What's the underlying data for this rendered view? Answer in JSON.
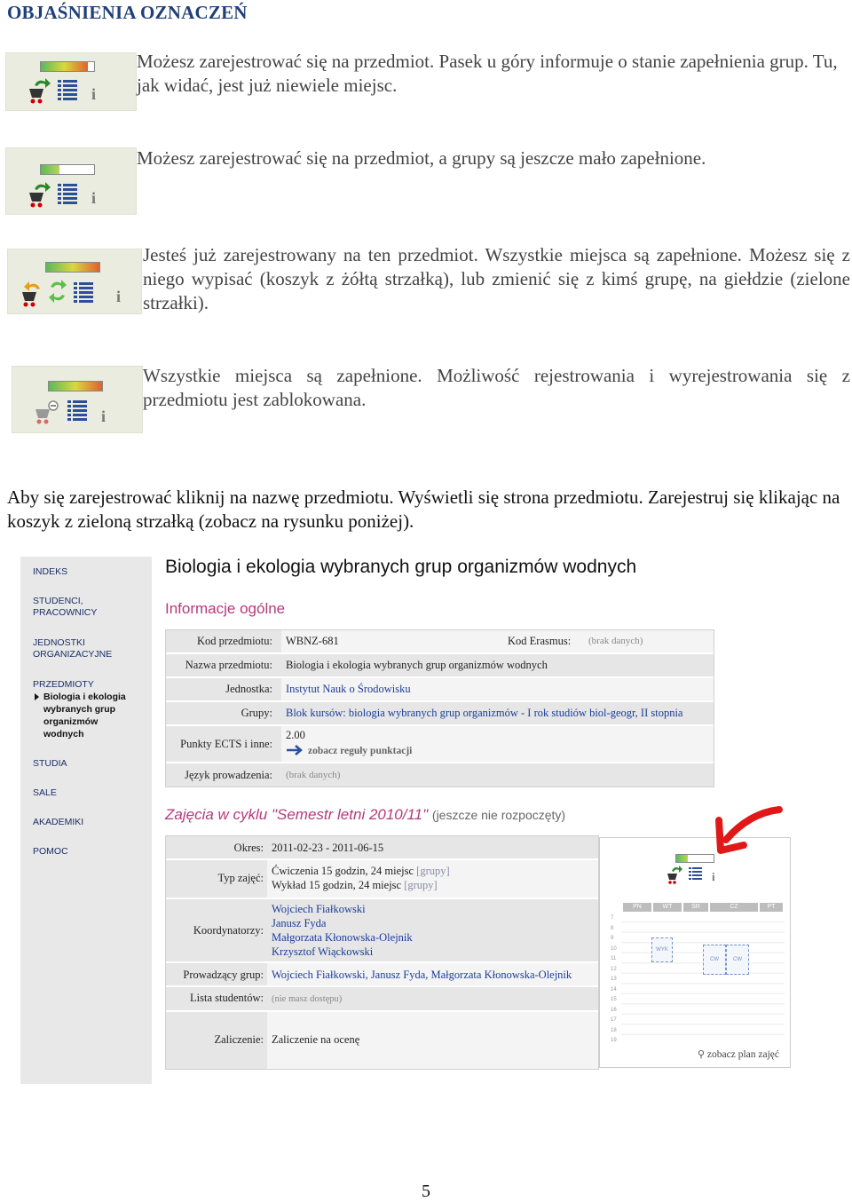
{
  "heading": "OBJAŚNIENIA OZNACZEŃ",
  "legend": [
    {
      "text": "Możesz zarejestrować się na przedmiot. Pasek u góry informuje o stanie zapełnienia grup. Tu, jak widać, jest już niewiele miejsc.",
      "fill_fraction": 0.88
    },
    {
      "text": "Możesz zarejestrować się na przedmiot, a grupy są jeszcze mało zapełnione.",
      "fill_fraction": 0.35
    },
    {
      "text": "Jesteś już zarejestrowany na ten przedmiot. Wszystkie miejsca są zapełnione. Możesz się z niego wypisać (koszyk z żółtą strzałką), lub zmienić się z kimś grupę, na giełdzie (zielone strzałki).",
      "fill_fraction": 1.0
    },
    {
      "text": "Wszystkie miejsca są zapełnione. Możliwość rejestrowania i wyrejestrowania się z przedmiotu jest zablokowana.",
      "fill_fraction": 1.0
    }
  ],
  "instruction": "Aby się zarejestrować kliknij na nazwę przedmiotu. Wyświetli się strona przedmiotu. Zarejestruj się klikając na koszyk z zieloną strzałką (zobacz na rysunku poniżej).",
  "screenshot": {
    "nav": {
      "indeks": "INDEKS",
      "studenci_1": "STUDENCI,",
      "studenci_2": "PRACOWNICY",
      "jednostki_1": "JEDNOSTKI",
      "jednostki_2": "ORGANIZACYJNE",
      "przedmioty": "PRZEDMIOTY",
      "current_1": "Biologia i ekologia",
      "current_2": "wybranych grup",
      "current_3": "organizmów",
      "current_4": "wodnych",
      "studia": "STUDIA",
      "sale": "SALE",
      "akademiki": "AKADEMIKI",
      "pomoc": "POMOC"
    },
    "course_title": "Biologia i ekologia wybranych grup organizmów wodnych",
    "general_heading": "Informacje ogólne",
    "general": {
      "kod_label": "Kod przedmiotu:",
      "kod_value": "WBNZ-681",
      "erasmus_label": "Kod Erasmus:",
      "erasmus_value": "(brak danych)",
      "nazwa_label": "Nazwa przedmiotu:",
      "nazwa_value": "Biologia i ekologia wybranych grup organizmów wodnych",
      "jednostka_label": "Jednostka:",
      "jednostka_value": "Instytut Nauk o Środowisku",
      "grupy_label": "Grupy:",
      "grupy_value": "Blok kursów: biologia wybranych grup organizmów - I rok studiów biol-geogr, II stopnia",
      "ects_label": "Punkty ECTS i inne:",
      "ects_value": "2.00",
      "ects_link": "zobacz reguły punktacji",
      "jezyk_label": "Język prowadzenia:",
      "jezyk_value": "(brak danych)"
    },
    "cycle_heading": "Zajęcia w cyklu \"Semestr letni 2010/11\"",
    "cycle_note": "(jeszcze nie rozpoczęty)",
    "cycle": {
      "okres_label": "Okres:",
      "okres_value": "2011-02-23 - 2011-06-15",
      "typ_label": "Typ zajęć:",
      "typ_1": "Ćwiczenia 15 godzin, 24 miejsc",
      "typ_1_link": "[grupy]",
      "typ_2": "Wykład 15 godzin, 24 miejsc",
      "typ_2_link": "[grupy]",
      "koord_label": "Koordynatorzy:",
      "koord": [
        "Wojciech Fiałkowski",
        "Janusz Fyda",
        "Małgorzata Kłonowska-Olejnik",
        "Krzysztof Wiąckowski"
      ],
      "prow_label": "Prowadzący grup:",
      "prow_value": "Wojciech Fiałkowski, Janusz Fyda, Małgorzata Kłonowska-Olejnik",
      "lista_label": "Lista studentów:",
      "lista_value": "(nie masz dostępu)",
      "zal_label": "Zaliczenie:",
      "zal_value": "Zaliczenie na ocenę"
    },
    "panel": {
      "fill_fraction": 0.3,
      "days": [
        "PN",
        "WT",
        "ŚR",
        "CZ",
        "PT"
      ],
      "hours": [
        "7",
        "8",
        "9",
        "10",
        "11",
        "12",
        "13",
        "14",
        "15",
        "16",
        "17",
        "18",
        "19"
      ],
      "blocks": [
        "WYK",
        "CW",
        "CW"
      ],
      "plan_link": "zobacz plan zajęć"
    }
  },
  "page_number": "5",
  "colors": {
    "accent_pink": "#b53a7c",
    "link_blue": "#1b3d99",
    "arrow_red": "#e01818"
  }
}
